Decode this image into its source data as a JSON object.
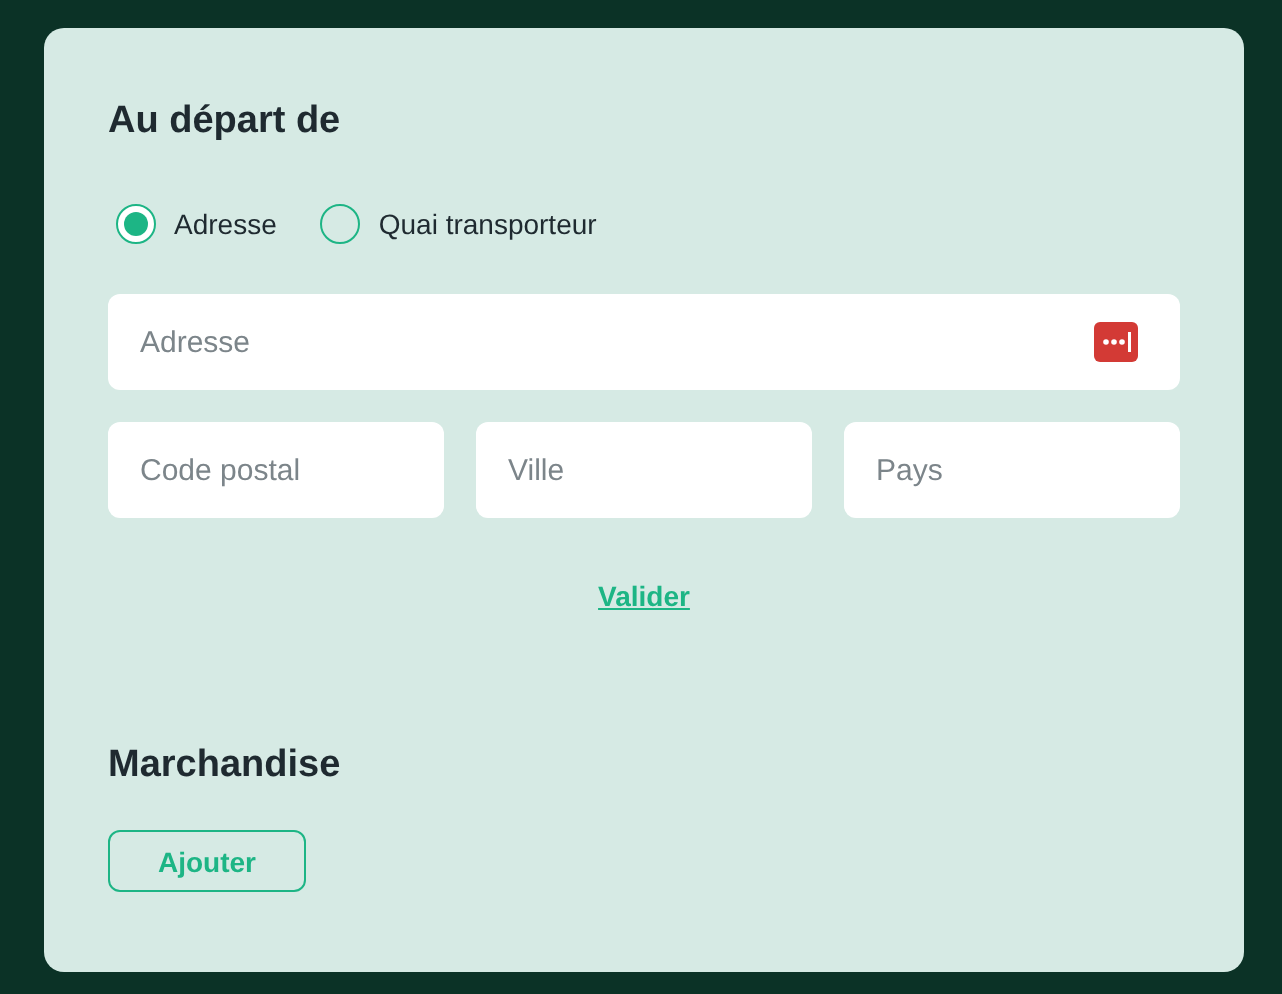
{
  "departure": {
    "title": "Au départ de",
    "options": [
      {
        "label": "Adresse",
        "selected": true
      },
      {
        "label": "Quai transporteur",
        "selected": false
      }
    ],
    "address": {
      "placeholder": "Adresse"
    },
    "fields": [
      {
        "placeholder": "Code postal"
      },
      {
        "placeholder": "Ville"
      },
      {
        "placeholder": "Pays"
      }
    ],
    "link": "Valider"
  },
  "goods": {
    "title": "Marchandise",
    "button": "Ajouter"
  }
}
